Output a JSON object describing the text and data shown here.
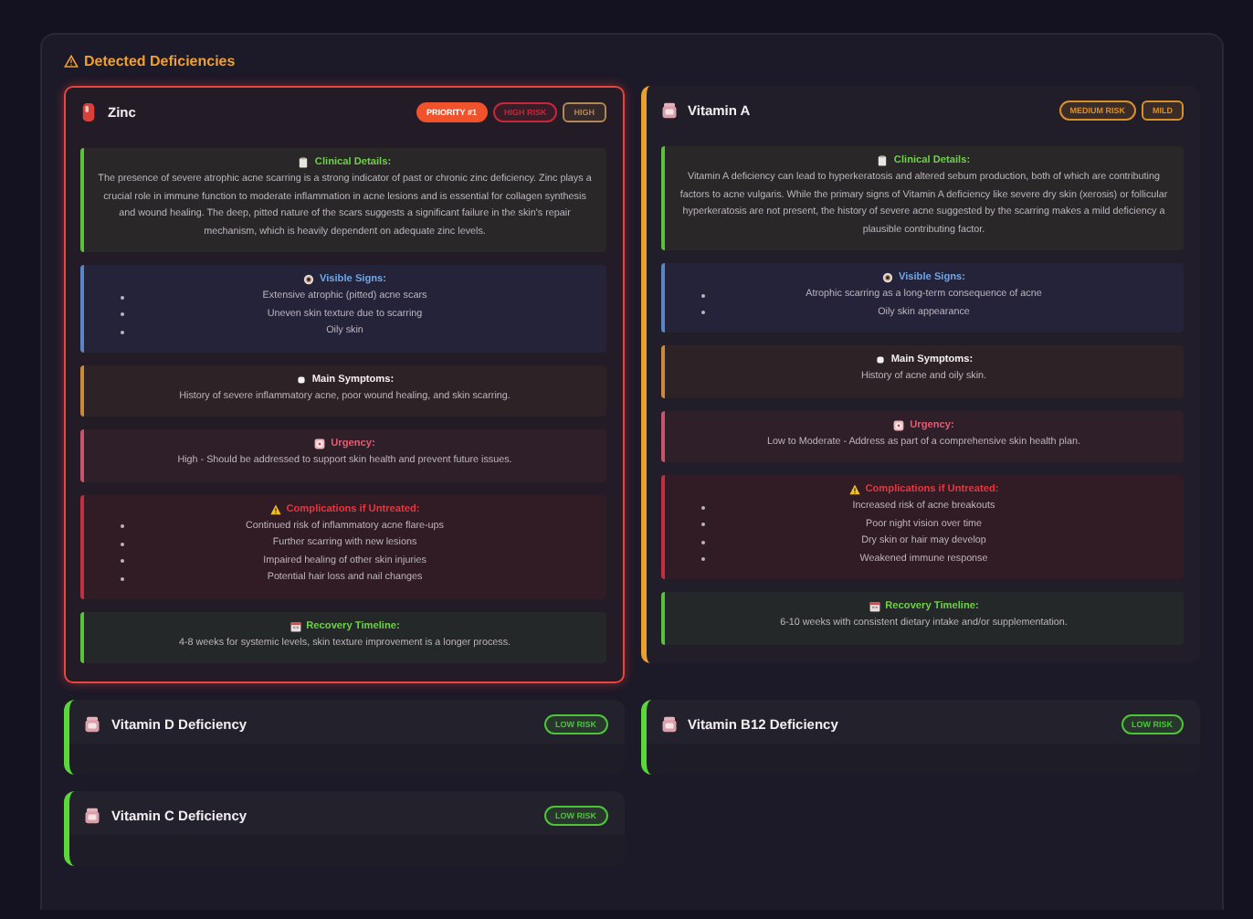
{
  "header": {
    "title": "Detected Deficiencies"
  },
  "cards": [
    {
      "name": "Zinc",
      "kind": "pill",
      "color": "#e8453c",
      "highlighted": true,
      "expanded": true,
      "badges": [
        {
          "text": "PRIORITY #1",
          "kind": "filled",
          "color": "#f0532c"
        },
        {
          "text": "HIGH RISK",
          "kind": "outline",
          "color": "#c6283a"
        },
        {
          "text": "HIGH",
          "kind": "outline",
          "color": "#b08a55"
        }
      ],
      "sections": [
        {
          "kind": "clinical",
          "title": "Clinical Details:",
          "text": "The presence of severe atrophic acne scarring is a strong indicator of past or chronic zinc deficiency. Zinc plays a crucial role in immune function to moderate inflammation in acne lesions and is essential for collagen synthesis and wound healing. The deep, pitted nature of the scars suggests a significant failure in the skin's repair mechanism, which is heavily dependent on adequate zinc levels."
        },
        {
          "kind": "visible",
          "title": "Visible Signs:",
          "items": [
            "Extensive atrophic (pitted) acne scars",
            "Uneven skin texture due to scarring",
            "Oily skin"
          ]
        },
        {
          "kind": "symptoms",
          "title": "Main Symptoms:",
          "text": "History of severe inflammatory acne, poor wound healing, and skin scarring."
        },
        {
          "kind": "urgency",
          "title": "Urgency:",
          "text": "High - Should be addressed to support skin health and prevent future issues."
        },
        {
          "kind": "complications",
          "title": "Complications if Untreated:",
          "items": [
            "Continued risk of inflammatory acne flare-ups",
            "Further scarring with new lesions",
            "Impaired healing of other skin injuries",
            "Potential hair loss and nail changes"
          ]
        },
        {
          "kind": "timeline",
          "title": "Recovery Timeline:",
          "text": "4-8 weeks for systemic levels, skin texture improvement is a longer process."
        }
      ]
    },
    {
      "name": "Vitamin A",
      "kind": "vitamin",
      "color": "#e8a030",
      "highlighted": false,
      "expanded": true,
      "badges": [
        {
          "text": "MEDIUM RISK",
          "kind": "outline",
          "color": "#d9902a"
        },
        {
          "text": "MILD",
          "kind": "outline",
          "color": "#d9902a"
        }
      ],
      "sections": [
        {
          "kind": "clinical",
          "title": "Clinical Details:",
          "text": "Vitamin A deficiency can lead to hyperkeratosis and altered sebum production, both of which are contributing factors to acne vulgaris. While the primary signs of Vitamin A deficiency like severe dry skin (xerosis) or follicular hyperkeratosis are not present, the history of severe acne suggested by the scarring makes a mild deficiency a plausible contributing factor."
        },
        {
          "kind": "visible",
          "title": "Visible Signs:",
          "items": [
            "Atrophic scarring as a long-term consequence of acne",
            "Oily skin appearance"
          ]
        },
        {
          "kind": "symptoms",
          "title": "Main Symptoms:",
          "text": "History of acne and oily skin."
        },
        {
          "kind": "urgency",
          "title": "Urgency:",
          "text": "Low to Moderate - Address as part of a comprehensive skin health plan."
        },
        {
          "kind": "complications",
          "title": "Complications if Untreated:",
          "items": [
            "Increased risk of acne breakouts",
            "Poor night vision over time",
            "Dry skin or hair may develop",
            "Weakened immune response"
          ]
        },
        {
          "kind": "timeline",
          "title": "Recovery Timeline:",
          "text": "6-10 weeks with consistent dietary intake and/or supplementation."
        }
      ]
    },
    {
      "name": "Vitamin D Deficiency",
      "kind": "vitamin",
      "color": "#5ad83a",
      "highlighted": false,
      "expanded": false,
      "badges": [
        {
          "text": "LOW RISK",
          "kind": "outline",
          "color": "#4cc43a"
        }
      ]
    },
    {
      "name": "Vitamin B12 Deficiency",
      "kind": "vitamin",
      "color": "#5ad83a",
      "highlighted": false,
      "expanded": false,
      "badges": [
        {
          "text": "LOW RISK",
          "kind": "outline",
          "color": "#4cc43a"
        }
      ]
    },
    {
      "name": "Vitamin C Deficiency",
      "kind": "vitamin",
      "color": "#5ad83a",
      "highlighted": false,
      "expanded": false,
      "badges": [
        {
          "text": "LOW RISK",
          "kind": "outline",
          "color": "#4cc43a"
        }
      ]
    }
  ]
}
